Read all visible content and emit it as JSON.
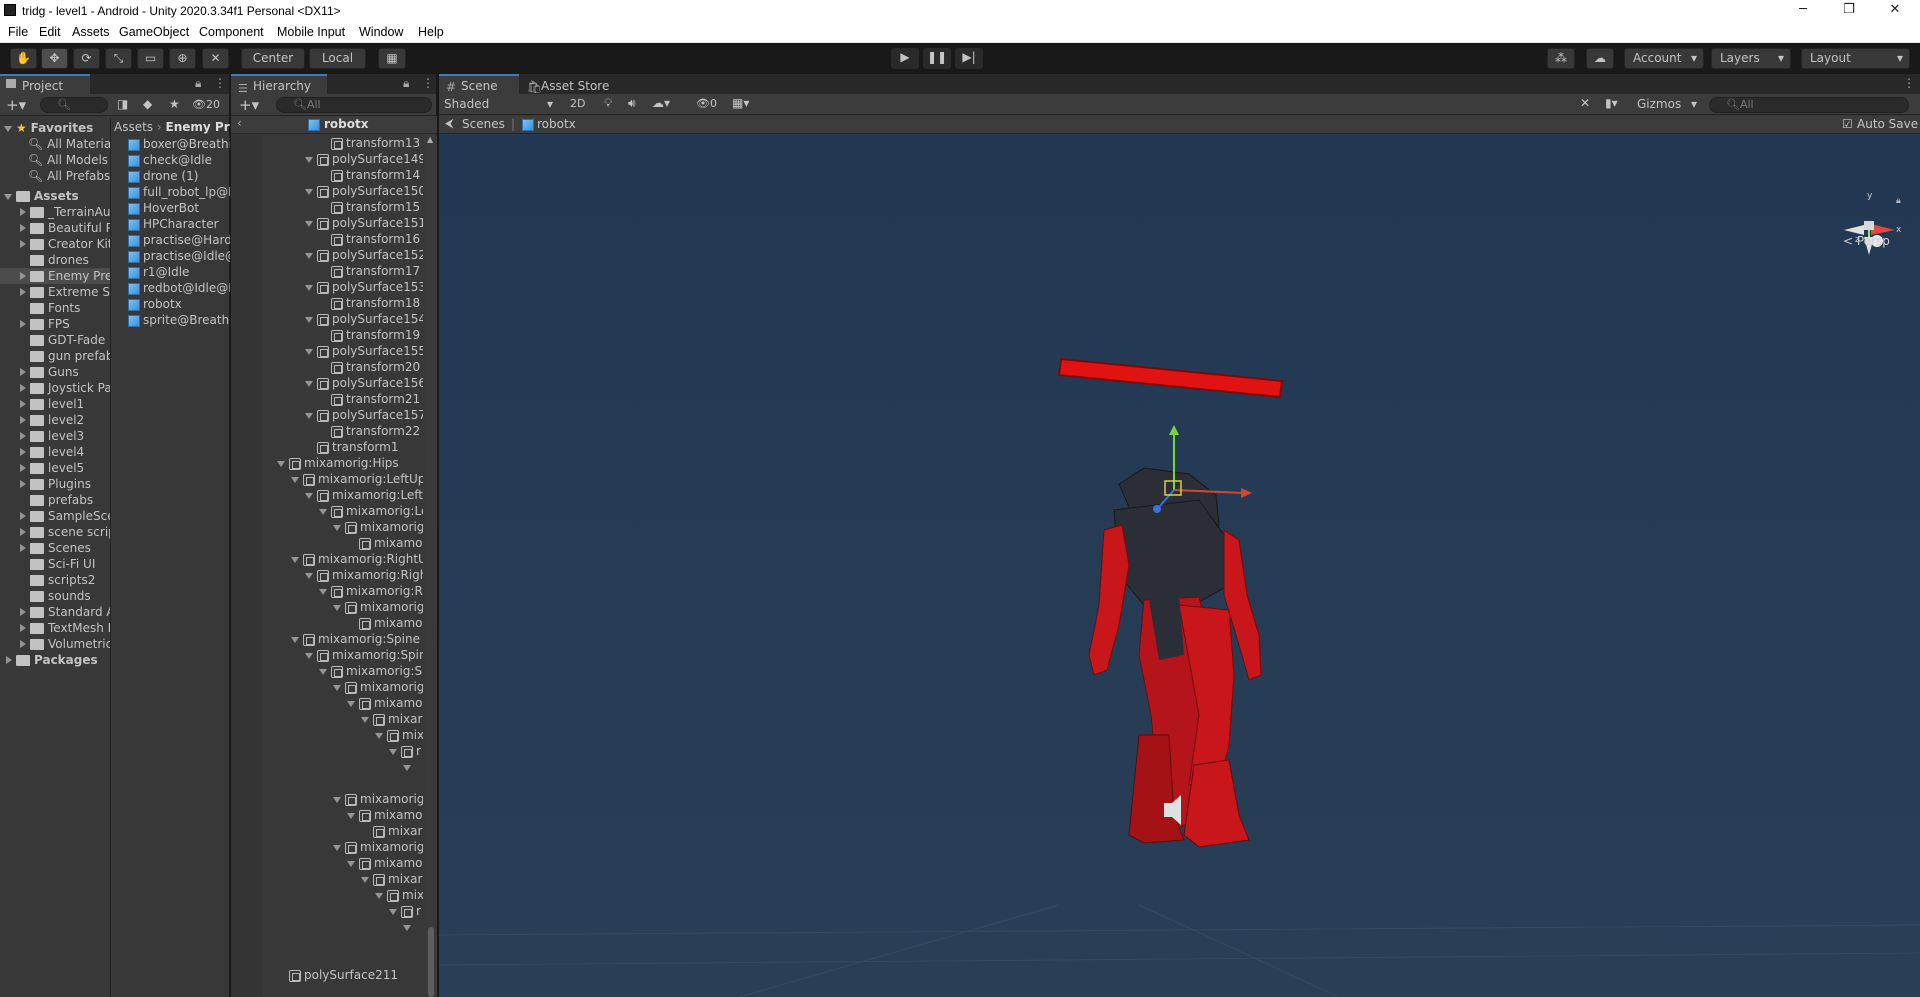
{
  "window": {
    "title": "tridg - level1 - Android - Unity 2020.3.34f1 Personal <DX11>",
    "minimize": "─",
    "maximize": "❐",
    "close": "✕"
  },
  "menu": [
    "File",
    "Edit",
    "Assets",
    "GameObject",
    "Component",
    "Mobile Input",
    "Window",
    "Help"
  ],
  "toolbar": {
    "pivot": "Center",
    "space": "Local",
    "account": "Account",
    "layers": "Layers",
    "layout": "Layout"
  },
  "project": {
    "tab": "Project",
    "hidden_count": "20",
    "search_placeholder": "",
    "favorites_label": "Favorites",
    "favorites": [
      "All Materia",
      "All Models",
      "All Prefabs"
    ],
    "assets_label": "Assets",
    "folders": [
      "_TerrainAu",
      "Beautiful P",
      "Creator Kit",
      "drones",
      "Enemy Pre",
      "Extreme Sc",
      "Fonts",
      "FPS",
      "GDT-Fade",
      "gun prefab",
      "Guns",
      "Joystick Pa",
      "level1",
      "level2",
      "level3",
      "level4",
      "level5",
      "Plugins",
      "prefabs",
      "SampleSce",
      "scene scrip",
      "Scenes",
      "Sci-Fi UI",
      "scripts2",
      "sounds",
      "Standard A",
      "TextMesh I",
      "Volumetric"
    ],
    "packages_label": "Packages",
    "breadcrumb": [
      "Assets",
      "Enemy Pre"
    ],
    "files": [
      "boxer@Breathin",
      "check@Idle",
      "drone (1)",
      "full_robot_lp@Id",
      "HoverBot",
      "HPCharacter",
      "practise@Hard",
      "practise@Idle@",
      "r1@Idle",
      "redbot@Idle@Id",
      "robotx",
      "sprite@Breathin"
    ]
  },
  "hierarchy": {
    "tab": "Hierarchy",
    "search_placeholder": "All",
    "root": "robotx",
    "rows": [
      {
        "label": "transform13",
        "indent": 4,
        "fold": "",
        "icon": "go"
      },
      {
        "label": "polySurface149",
        "indent": 3,
        "fold": "open",
        "icon": "go"
      },
      {
        "label": "transform14",
        "indent": 4,
        "fold": "",
        "icon": "go"
      },
      {
        "label": "polySurface150",
        "indent": 3,
        "fold": "open",
        "icon": "go"
      },
      {
        "label": "transform15",
        "indent": 4,
        "fold": "",
        "icon": "go"
      },
      {
        "label": "polySurface151",
        "indent": 3,
        "fold": "open",
        "icon": "go"
      },
      {
        "label": "transform16",
        "indent": 4,
        "fold": "",
        "icon": "go"
      },
      {
        "label": "polySurface152",
        "indent": 3,
        "fold": "open",
        "icon": "go"
      },
      {
        "label": "transform17",
        "indent": 4,
        "fold": "",
        "icon": "go"
      },
      {
        "label": "polySurface153",
        "indent": 3,
        "fold": "open",
        "icon": "go"
      },
      {
        "label": "transform18",
        "indent": 4,
        "fold": "",
        "icon": "go"
      },
      {
        "label": "polySurface154",
        "indent": 3,
        "fold": "open",
        "icon": "go"
      },
      {
        "label": "transform19",
        "indent": 4,
        "fold": "",
        "icon": "go"
      },
      {
        "label": "polySurface155",
        "indent": 3,
        "fold": "open",
        "icon": "go"
      },
      {
        "label": "transform20",
        "indent": 4,
        "fold": "",
        "icon": "go"
      },
      {
        "label": "polySurface156",
        "indent": 3,
        "fold": "open",
        "icon": "go"
      },
      {
        "label": "transform21",
        "indent": 4,
        "fold": "",
        "icon": "go"
      },
      {
        "label": "polySurface157",
        "indent": 3,
        "fold": "open",
        "icon": "go"
      },
      {
        "label": "transform22",
        "indent": 4,
        "fold": "",
        "icon": "go"
      },
      {
        "label": "transform1",
        "indent": 3,
        "fold": "",
        "icon": "go"
      },
      {
        "label": "mixamorig:Hips",
        "indent": 1,
        "fold": "open",
        "icon": "go"
      },
      {
        "label": "mixamorig:LeftUpL",
        "indent": 2,
        "fold": "open",
        "icon": "go"
      },
      {
        "label": "mixamorig:LeftL",
        "indent": 3,
        "fold": "open",
        "icon": "go"
      },
      {
        "label": "mixamorig:Le",
        "indent": 4,
        "fold": "open",
        "icon": "go"
      },
      {
        "label": "mixamorig",
        "indent": 5,
        "fold": "open",
        "icon": "go"
      },
      {
        "label": "mixamo",
        "indent": 6,
        "fold": "",
        "icon": "go"
      },
      {
        "label": "mixamorig:RightUp",
        "indent": 2,
        "fold": "open",
        "icon": "go"
      },
      {
        "label": "mixamorig:Righ",
        "indent": 3,
        "fold": "open",
        "icon": "go"
      },
      {
        "label": "mixamorig:Ri",
        "indent": 4,
        "fold": "open",
        "icon": "go"
      },
      {
        "label": "mixamorig",
        "indent": 5,
        "fold": "open",
        "icon": "go"
      },
      {
        "label": "mixamo",
        "indent": 6,
        "fold": "",
        "icon": "go"
      },
      {
        "label": "mixamorig:Spine",
        "indent": 2,
        "fold": "open",
        "icon": "go"
      },
      {
        "label": "mixamorig:Spin",
        "indent": 3,
        "fold": "open",
        "icon": "go"
      },
      {
        "label": "mixamorig:Sp",
        "indent": 4,
        "fold": "open",
        "icon": "go"
      },
      {
        "label": "mixamorig",
        "indent": 5,
        "fold": "open",
        "icon": "go"
      },
      {
        "label": "mixamo",
        "indent": 6,
        "fold": "open",
        "icon": "go"
      },
      {
        "label": "mixar",
        "indent": 7,
        "fold": "open",
        "icon": "go"
      },
      {
        "label": "mix",
        "indent": 8,
        "fold": "open",
        "icon": "go"
      },
      {
        "label": "r",
        "indent": 9,
        "fold": "open",
        "icon": "go"
      },
      {
        "label": "",
        "indent": 10,
        "fold": "open",
        "icon": "none"
      },
      {
        "label": "",
        "indent": 10,
        "fold": "",
        "icon": "none"
      },
      {
        "label": "mixamorig",
        "indent": 5,
        "fold": "open",
        "icon": "go"
      },
      {
        "label": "mixamo",
        "indent": 6,
        "fold": "open",
        "icon": "go"
      },
      {
        "label": "mixar",
        "indent": 7,
        "fold": "",
        "icon": "go"
      },
      {
        "label": "mixamorig",
        "indent": 5,
        "fold": "open",
        "icon": "go"
      },
      {
        "label": "mixamo",
        "indent": 6,
        "fold": "open",
        "icon": "go"
      },
      {
        "label": "mixar",
        "indent": 7,
        "fold": "open",
        "icon": "go"
      },
      {
        "label": "mix",
        "indent": 8,
        "fold": "open",
        "icon": "go"
      },
      {
        "label": "r",
        "indent": 9,
        "fold": "open",
        "icon": "go"
      },
      {
        "label": "",
        "indent": 10,
        "fold": "open",
        "icon": "none"
      },
      {
        "label": "",
        "indent": 10,
        "fold": "",
        "icon": "none"
      },
      {
        "label": "",
        "indent": 0,
        "fold": "",
        "icon": "none"
      },
      {
        "label": "polySurface211",
        "indent": 1,
        "fold": "",
        "icon": "go"
      }
    ]
  },
  "scene": {
    "tabs": [
      "Scene",
      "Asset Store"
    ],
    "shading": "Shaded",
    "mode_2d": "2D",
    "hidden_count": "0",
    "gizmos": "Gizmos",
    "search_placeholder": "All",
    "breadcrumb": [
      "Scenes",
      "robotx"
    ],
    "auto_save": "Auto Save",
    "projection": "Persp",
    "colors": {
      "robot_red": "#c8161a",
      "robot_dark": "#2b2e36",
      "sky": "#283a50",
      "healthbar": "#e11212"
    }
  }
}
